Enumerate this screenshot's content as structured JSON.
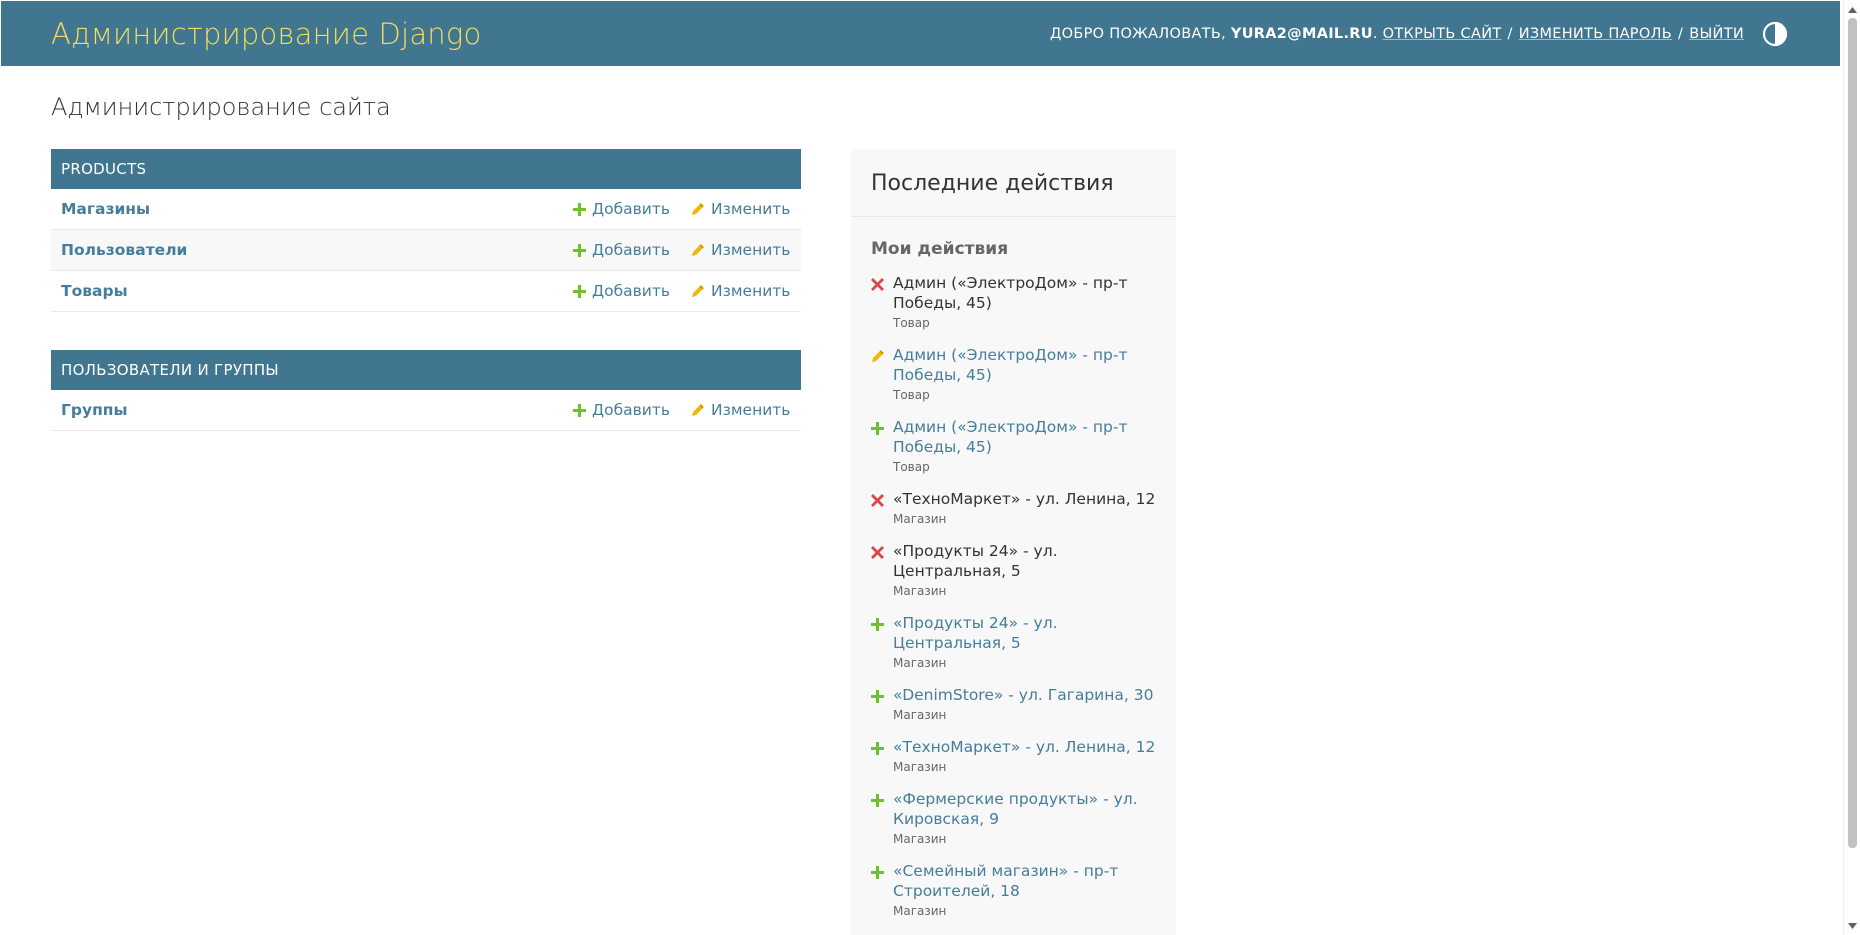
{
  "header": {
    "site_name": "Администрирование Django",
    "welcome": "Добро пожаловать,",
    "username": "yura2@mail.ru",
    "view_site": "Открыть сайт",
    "change_password": "Изменить пароль",
    "logout": "Выйти"
  },
  "page_title": "Администрирование сайта",
  "modules": [
    {
      "caption": "Products",
      "models": [
        {
          "name": "Магазины",
          "add": "Добавить",
          "change": "Изменить"
        },
        {
          "name": "Пользователи",
          "add": "Добавить",
          "change": "Изменить"
        },
        {
          "name": "Товары",
          "add": "Добавить",
          "change": "Изменить"
        }
      ]
    },
    {
      "caption": "Пользователи и группы",
      "models": [
        {
          "name": "Группы",
          "add": "Добавить",
          "change": "Изменить"
        }
      ]
    }
  ],
  "recent": {
    "title": "Последние действия",
    "subtitle": "Мои действия",
    "items": [
      {
        "action": "delete",
        "title": "Админ («ЭлектроДом» - пр-т Победы, 45)",
        "type": "Товар"
      },
      {
        "action": "change",
        "title": "Админ («ЭлектроДом» - пр-т Победы, 45)",
        "type": "Товар"
      },
      {
        "action": "add",
        "title": "Админ («ЭлектроДом» - пр-т Победы, 45)",
        "type": "Товар"
      },
      {
        "action": "delete",
        "title": "«ТехноМаркет» - ул. Ленина, 12",
        "type": "Магазин"
      },
      {
        "action": "delete",
        "title": "«Продукты 24» - ул. Центральная, 5",
        "type": "Магазин"
      },
      {
        "action": "add",
        "title": "«Продукты 24» - ул. Центральная, 5",
        "type": "Магазин"
      },
      {
        "action": "add",
        "title": "«DenimStore» - ул. Гагарина, 30",
        "type": "Магазин"
      },
      {
        "action": "add",
        "title": "«ТехноМаркет» - ул. Ленина, 12",
        "type": "Магазин"
      },
      {
        "action": "add",
        "title": "«Фермерские продукты» - ул. Кировская, 9",
        "type": "Магазин"
      },
      {
        "action": "add",
        "title": "«Семейный магазин» - пр-т Строителей, 18",
        "type": "Магазин"
      }
    ]
  },
  "colors": {
    "header_bg": "#417690",
    "site_name": "#f5dd5d",
    "link": "#447e9b",
    "add_icon": "#70bf2b",
    "change_icon": "#efb80b",
    "delete_icon": "#dd4646"
  },
  "icons": {
    "theme_toggle": "half-circle-icon",
    "add": "plus-icon",
    "change": "pencil-icon",
    "delete": "cross-icon"
  }
}
